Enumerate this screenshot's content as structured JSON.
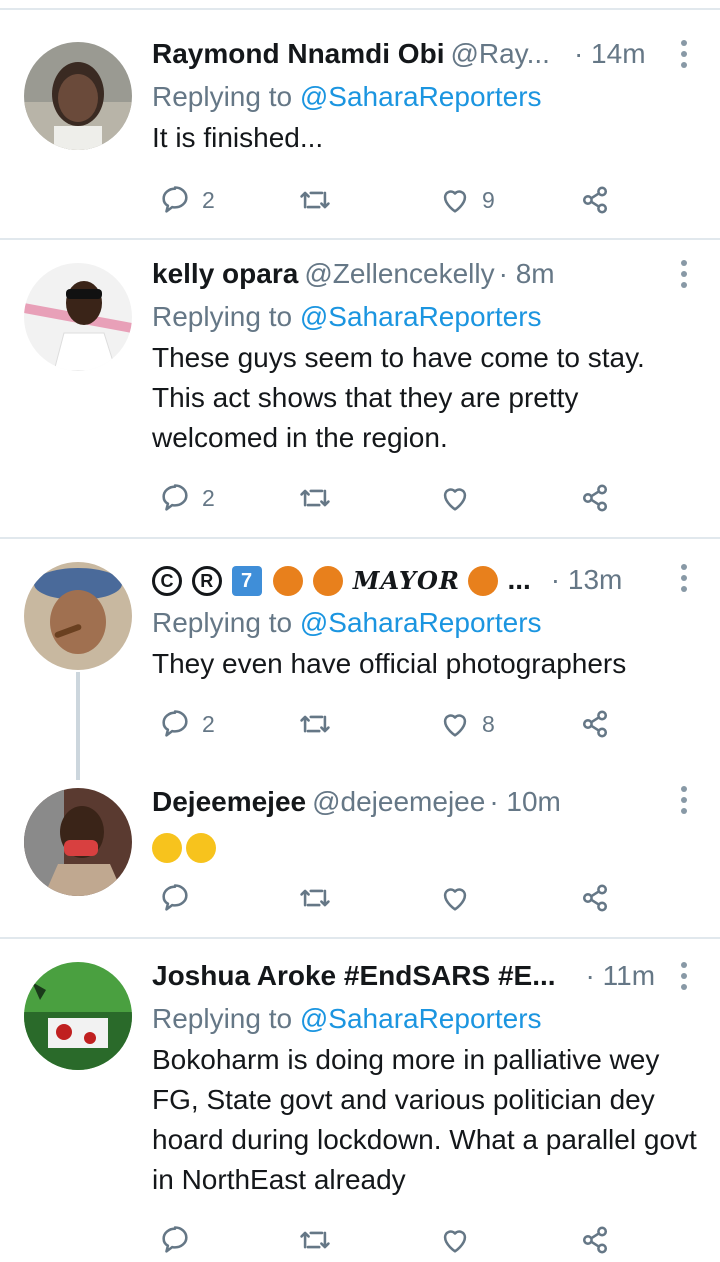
{
  "tweets": [
    {
      "name": "Raymond Nnamdi Obi",
      "handle": "@Ray...",
      "time": "· 14m",
      "replying_label": "Replying to",
      "replying_to": "@SaharaReporters",
      "text": "It is finished...",
      "replies": "2",
      "retweets": "",
      "likes": "9"
    },
    {
      "name": "kelly opara",
      "handle": "@Zellencekelly",
      "time": "· 8m",
      "replying_label": "Replying to",
      "replying_to": "@SaharaReporters",
      "text": "These guys seem to have come to stay. This act shows that they are pretty welcomed in the region.",
      "replies": "2",
      "retweets": "",
      "likes": ""
    },
    {
      "name_suffix": "...",
      "name_script": "MAYOR",
      "name_circled": [
        "C",
        "R"
      ],
      "name_keycap": "7",
      "time": "· 13m",
      "replying_label": "Replying to",
      "replying_to": "@SaharaReporters",
      "text": "They even have official photographers",
      "replies": "2",
      "retweets": "",
      "likes": "8"
    },
    {
      "name": "Dejeemejee",
      "handle": "@dejeemejee",
      "time": "· 10m",
      "emoji": [
        "rofl-emoji",
        "rofl-emoji"
      ],
      "replies": "",
      "retweets": "",
      "likes": ""
    },
    {
      "name": "Joshua Aroke #EndSARS #E...",
      "time": "· 11m",
      "replying_label": "Replying to",
      "replying_to": "@SaharaReporters",
      "text": "Bokoharm is doing more in palliative wey FG, State govt and various politician dey hoard during lockdown. What a parallel govt in NorthEast already"
    }
  ],
  "icons": {
    "reply": "reply-icon",
    "retweet": "retweet-icon",
    "like": "heart-icon",
    "share": "share-icon",
    "more": "more-vertical-icon"
  },
  "colors": {
    "mention": "#1b95e0",
    "secondary_text": "#657786",
    "divider": "#e1e8ed"
  }
}
